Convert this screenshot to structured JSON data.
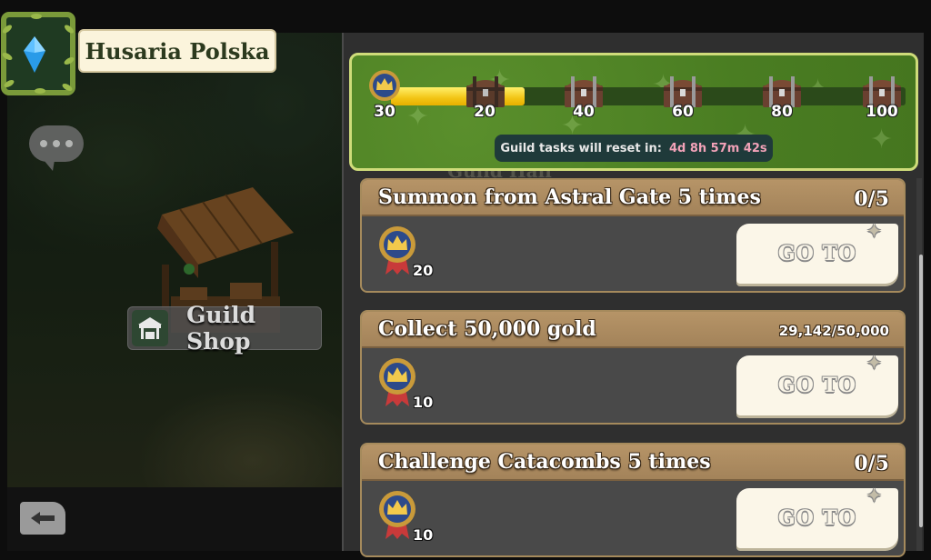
{
  "guild": {
    "name": "Husaria Polska"
  },
  "left": {
    "guild_shop_label": "Guild Shop"
  },
  "progress": {
    "current_points": "30",
    "fill_fraction": 0.26,
    "milestones": [
      "20",
      "40",
      "60",
      "80",
      "100"
    ],
    "reset_label": "Guild tasks will reset in:",
    "reset_time": "4d 8h 57m 42s"
  },
  "tasks": [
    {
      "title": "Summon from Astral Gate 5 times",
      "progress": "0/5",
      "reward": "20",
      "button": "GO TO"
    },
    {
      "title": "Collect 50,000 gold",
      "progress": "29,142/50,000",
      "reward": "10",
      "button": "GO TO"
    },
    {
      "title": "Challenge Catacombs 5 times",
      "progress": "0/5",
      "reward": "10",
      "button": "GO TO"
    }
  ],
  "background_ghost": {
    "title": "Guild Hall"
  },
  "colors": {
    "progress_green": "#4a7d22",
    "progress_fill": "#f2c414",
    "task_header": "#a3835a",
    "button_cream": "#fbf6e8",
    "reset_time": "#f2a2b8"
  },
  "icons": {
    "crest": "blue-crystal-icon",
    "chat": "chat-bubble-icon",
    "shop": "shop-stall-icon",
    "back": "back-arrow-icon",
    "points": "crown-medal-icon",
    "chest": "treasure-chest-icon"
  }
}
